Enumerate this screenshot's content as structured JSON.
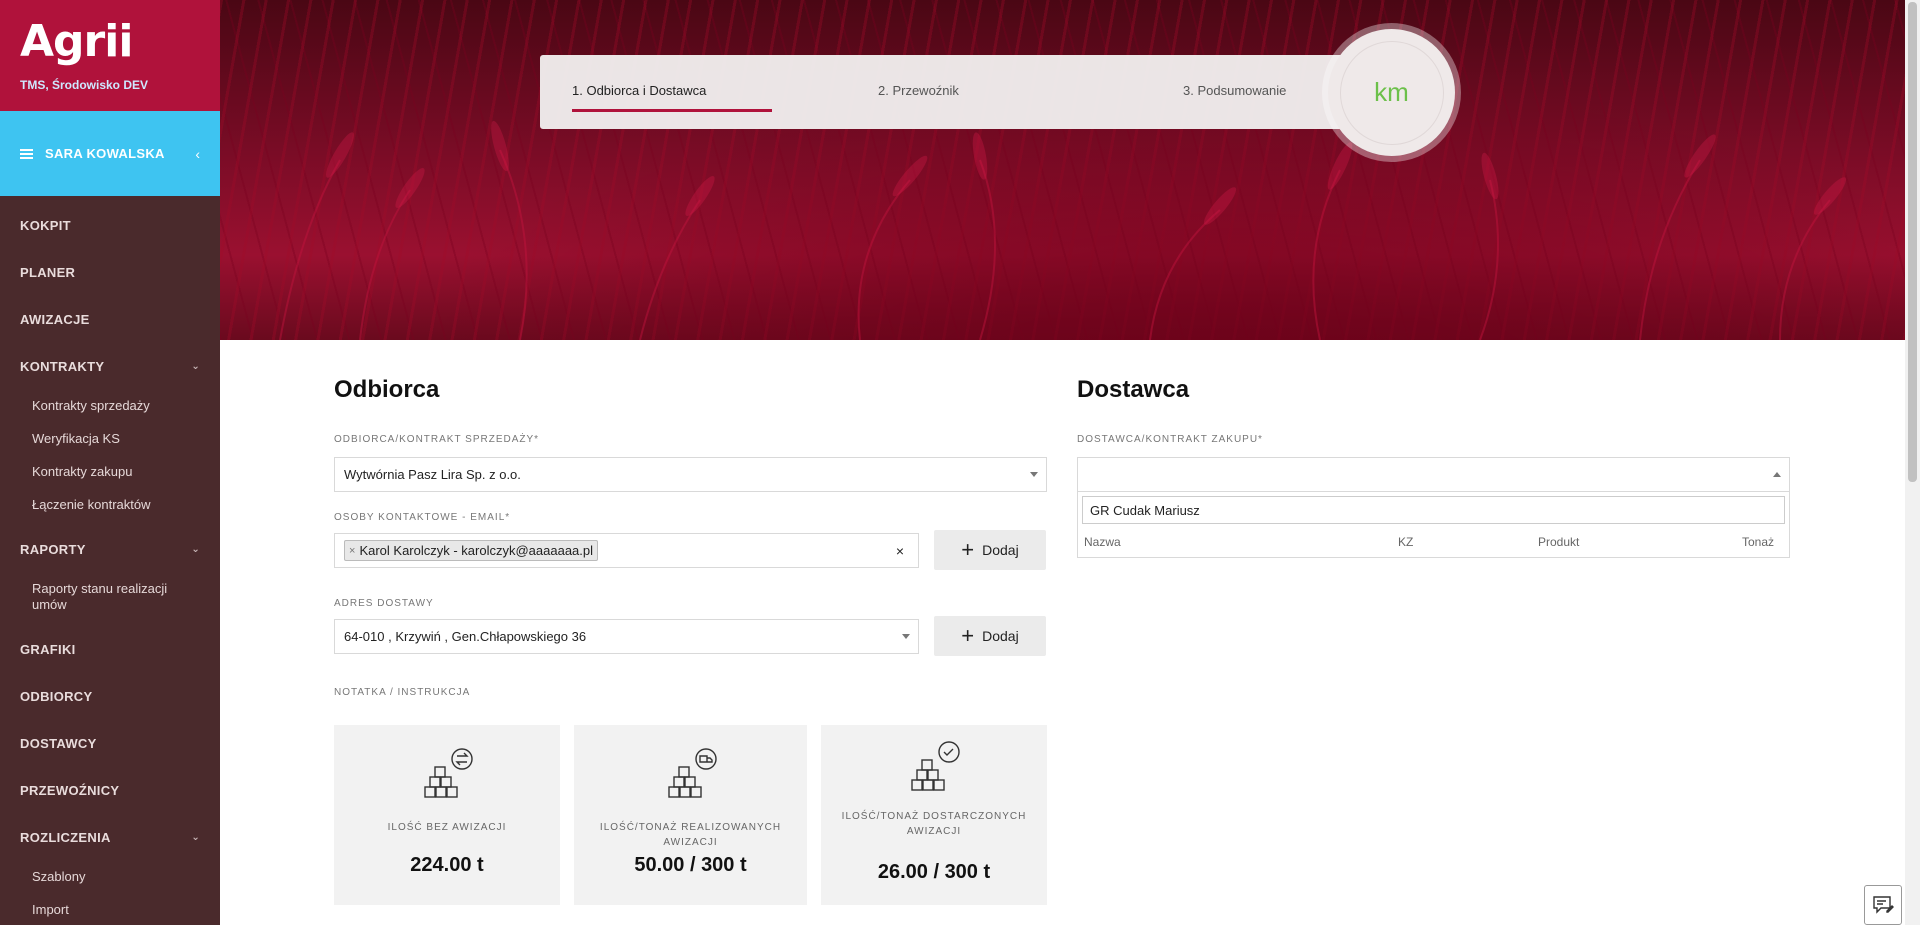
{
  "sidebar": {
    "logo": "Agrii",
    "environment": "TMS, Środowisko DEV",
    "user": "SARA KOWALSKA",
    "nav": [
      {
        "label": "KOKPIT",
        "children": []
      },
      {
        "label": "PLANER",
        "children": []
      },
      {
        "label": "AWIZACJE",
        "children": []
      },
      {
        "label": "KONTRAKTY",
        "children": [
          "Kontrakty sprzedaży",
          "Weryfikacja KS",
          "Kontrakty zakupu",
          "Łączenie kontraktów"
        ]
      },
      {
        "label": "RAPORTY",
        "children": [
          "Raporty stanu realizacji umów"
        ]
      },
      {
        "label": "GRAFIKI",
        "children": []
      },
      {
        "label": "ODBIORCY",
        "children": []
      },
      {
        "label": "DOSTAWCY",
        "children": []
      },
      {
        "label": "PRZEWOŹNICY",
        "children": []
      },
      {
        "label": "ROZLICZENIA",
        "children": [
          "Szablony",
          "Import"
        ]
      }
    ]
  },
  "stepper": {
    "steps": [
      "1. Odbiorca i Dostawca",
      "2. Przewoźnik",
      "3. Podsumowanie"
    ],
    "active_index": 0,
    "distance_label": "km"
  },
  "odbiorca": {
    "heading": "Odbiorca",
    "contract_label": "ODBIORCA/KONTRAKT SPRZEDAŻY*",
    "contract_value": "Wytwórnia Pasz Lira Sp. z o.o.",
    "contacts_label": "OSOBY KONTAKTOWE - EMAIL*",
    "contact_tag": "Karol Karolczyk - karolczyk@aaaaaaa.pl",
    "add_label": "Dodaj",
    "address_label": "ADRES DOSTAWY",
    "address_value": "64-010 , Krzywiń , Gen.Chłapowskiego 36",
    "note_label": "NOTATKA / INSTRUKCJA"
  },
  "dostawca": {
    "heading": "Dostawca",
    "contract_label": "DOSTAWCA/KONTRAKT ZAKUPU*",
    "search_value": "GR Cudak Mariusz",
    "columns": [
      "Nazwa",
      "KZ",
      "Produkt",
      "Tonaż"
    ]
  },
  "stats": [
    {
      "title": "ILOŚĆ BEZ AWIZACJI",
      "value": "224.00 t",
      "icon": "boxes-exchange-icon"
    },
    {
      "title": "ILOŚĆ/TONAŻ REALIZOWANYCH AWIZACJI",
      "value": "50.00 / 300 t",
      "icon": "boxes-truck-icon"
    },
    {
      "title": "ILOŚĆ/TONAŻ DOSTARCZONYCH AWIZACJI",
      "value": "26.00 / 300 t",
      "icon": "boxes-check-icon"
    }
  ],
  "colors": {
    "brand": "#b0123b",
    "user_bar": "#3ec4f1",
    "sidebar": "#4a2a2c",
    "km": "#6cc04a"
  }
}
